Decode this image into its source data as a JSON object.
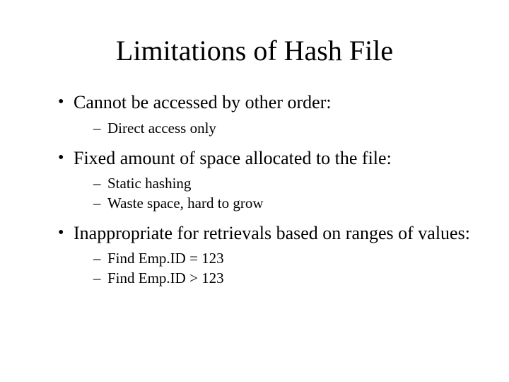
{
  "title": "Limitations of Hash File",
  "bullets": [
    {
      "text": "Cannot be accessed by other order:",
      "sub": [
        {
          "text": "Direct access only"
        }
      ]
    },
    {
      "text": "Fixed amount of space allocated to the file:",
      "sub": [
        {
          "text": "Static hashing"
        },
        {
          "text": "Waste space, hard to grow"
        }
      ]
    },
    {
      "text": "Inappropriate for retrievals based on ranges of values:",
      "sub": [
        {
          "text": "Find Emp.ID = 123"
        },
        {
          "text": "Find Emp.ID > 123"
        }
      ]
    }
  ]
}
